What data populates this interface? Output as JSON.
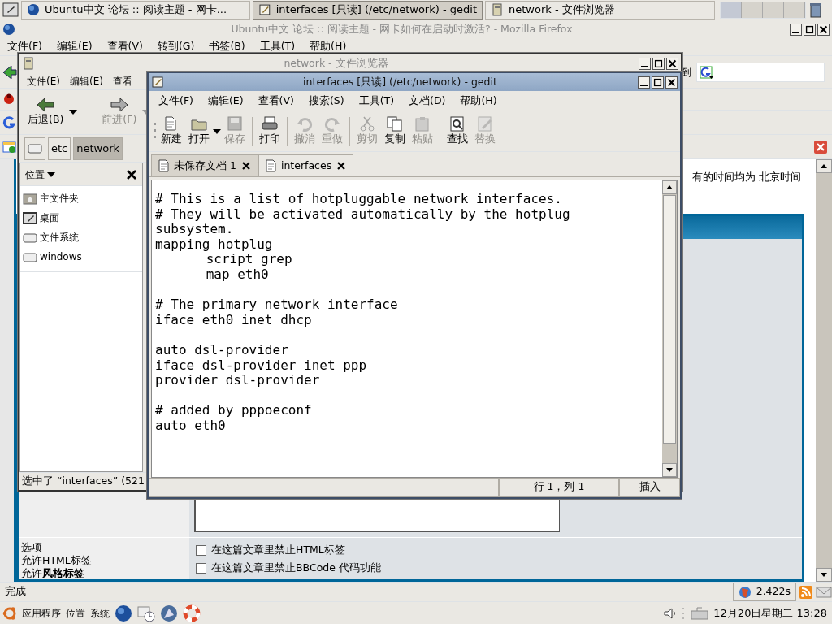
{
  "top_panel": {
    "tasks": [
      {
        "label": "Ubuntu中文 论坛 :: 阅读主题 - 网卡...",
        "selected": false
      },
      {
        "label": "interfaces [只读] (/etc/network) - gedit",
        "selected": true
      },
      {
        "label": "network - 文件浏览器",
        "selected": false
      }
    ]
  },
  "firefox": {
    "title": "Ubuntu中文 论坛 :: 阅读主题 - 网卡如何在启动时激活? - Mozilla Firefox",
    "menu": [
      "文件(F)",
      "编辑(E)",
      "查看(V)",
      "转到(G)",
      "书签(B)",
      "工具(T)",
      "帮助(H)"
    ],
    "go_label": "到",
    "page": {
      "timezone_note": "有的时间均为 北京时间",
      "options_heading": "选项",
      "option_notes": [
        "允许HTML标签",
        "允许**风格标签**"
      ],
      "checkboxes": [
        {
          "label": "在这篇文章里禁止HTML标签",
          "checked": false
        },
        {
          "label": "在这篇文章里禁止BBCode 代码功能",
          "checked": false
        }
      ]
    },
    "status": {
      "text": "完成",
      "timing": "2.422s"
    }
  },
  "file_browser": {
    "title": "network - 文件浏览器",
    "menu": [
      "文件(E)",
      "编辑(E)",
      "查看"
    ],
    "back": {
      "label": "后退(B)",
      "disabled": false
    },
    "forward": {
      "label": "前进(F)",
      "disabled": true
    },
    "path": [
      {
        "label": "etc",
        "selected": false
      },
      {
        "label": "network",
        "selected": true
      }
    ],
    "side_pane_title": "位置",
    "places": [
      "主文件夹",
      "桌面",
      "文件系统",
      "windows"
    ],
    "status": "选中了 “interfaces” (521"
  },
  "gedit": {
    "title": "interfaces [只读] (/etc/network) - gedit",
    "menu": [
      "文件(F)",
      "编辑(E)",
      "查看(V)",
      "搜索(S)",
      "工具(T)",
      "文档(D)",
      "帮助(H)"
    ],
    "toolbar": [
      {
        "items": [
          {
            "label": "新建",
            "disabled": false
          },
          {
            "label": "打开",
            "disabled": false
          },
          {
            "label": "保存",
            "disabled": true
          }
        ]
      },
      {
        "items": [
          {
            "label": "打印",
            "disabled": false
          }
        ]
      },
      {
        "items": [
          {
            "label": "撤消",
            "disabled": true
          },
          {
            "label": "重做",
            "disabled": true
          }
        ]
      },
      {
        "items": [
          {
            "label": "剪切",
            "disabled": true
          },
          {
            "label": "复制",
            "disabled": false
          },
          {
            "label": "粘贴",
            "disabled": true
          }
        ]
      },
      {
        "items": [
          {
            "label": "查找",
            "disabled": false
          },
          {
            "label": "替换",
            "disabled": true
          }
        ]
      }
    ],
    "tabs": [
      {
        "label": "未保存文档 1",
        "selected": false
      },
      {
        "label": "interfaces",
        "selected": true
      }
    ],
    "text": "# This is a list of hotpluggable network interfaces.\n# They will be activated automatically by the hotplug\nsubsystem.\nmapping hotplug\n\tscript grep\n\tmap eth0\n\n# The primary network interface\niface eth0 inet dhcp\n\nauto dsl-provider\niface dsl-provider inet ppp\nprovider dsl-provider\n\n# added by pppoeconf\nauto eth0",
    "status": {
      "position": "行 1，列 1",
      "mode": "插入"
    }
  },
  "bottom_panel": {
    "menus": [
      "应用程序",
      "位置",
      "系统"
    ],
    "clock": "12月20日星期二 13:28"
  }
}
